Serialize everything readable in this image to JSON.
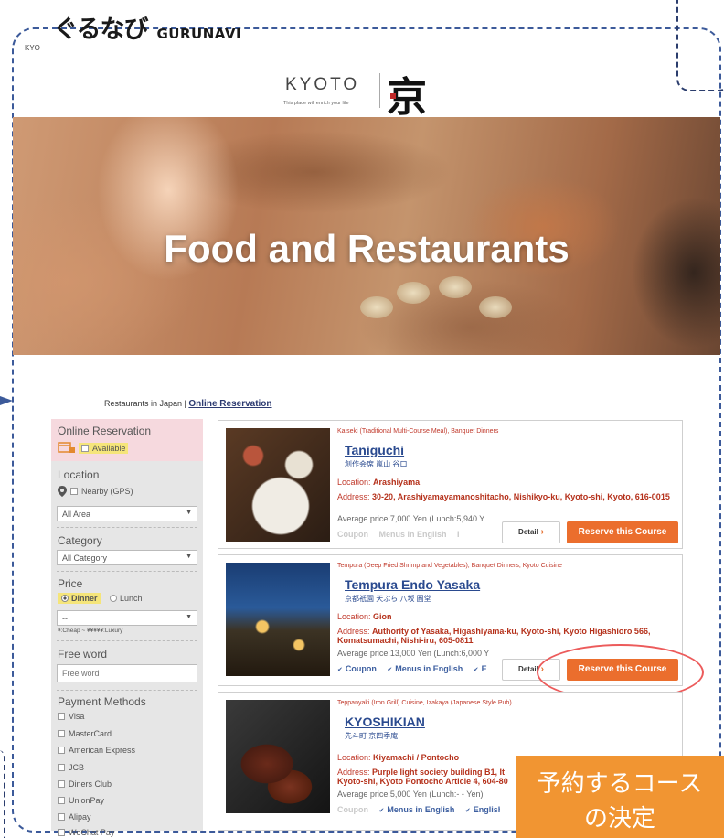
{
  "logo": {
    "jp": "ぐるなび",
    "en": "GURUNAVI"
  },
  "stray_text": "KYO",
  "brand": {
    "word": "KYOTO",
    "tagline": "This place will enrich your life",
    "kanji": "京"
  },
  "hero": {
    "title": "Food and Restaurants"
  },
  "breadcrumb": {
    "prefix": "Restaurants in Japan | ",
    "link": "Online Reservation"
  },
  "sidebar": {
    "online": {
      "heading": "Online Reservation",
      "available": "Available"
    },
    "location": {
      "heading": "Location",
      "gps": "Nearby (GPS)",
      "area": "All Area"
    },
    "category": {
      "heading": "Category",
      "value": "All Category"
    },
    "price": {
      "heading": "Price",
      "dinner": "Dinner",
      "lunch": "Lunch",
      "select": "--",
      "legend": "¥:Cheap ~ ¥¥¥¥¥:Luxury"
    },
    "freeword": {
      "heading": "Free word",
      "placeholder": "Free word"
    },
    "payment": {
      "heading": "Payment Methods",
      "methods": [
        "Visa",
        "MasterCard",
        "American Express",
        "JCB",
        "Diners Club",
        "UnionPay",
        "Alipay",
        "WeChat Pay"
      ]
    }
  },
  "restaurants": [
    {
      "genre": "Kaiseki (Traditional Multi-Course Meal), Banquet Dinners",
      "name": "Taniguchi",
      "name_jp": "創作会席 嵐山 谷口",
      "location_label": "Location:",
      "location": "Arashiyama",
      "address_label": "Address:",
      "address": "30-20, Arashiyamayamanoshitacho, Nishikyo-ku, Kyoto-shi, Kyoto, 616-0015",
      "price": "Average price:7,000 Yen (Lunch:5,940 Y",
      "tags": [
        "Coupon",
        "Menus in English",
        "I"
      ],
      "tags_active": false
    },
    {
      "genre": "Tempura (Deep Fried Shrimp and Vegetables), Banquet Dinners, Kyoto Cuisine",
      "name": "Tempura Endo Yasaka",
      "name_jp": "京都祇園 天ぷら 八坂 圓堂",
      "location_label": "Location:",
      "location": "Gion",
      "address_label": "Address:",
      "address": "Authority of Yasaka, Higashiyama-ku, Kyoto-shi, Kyoto Higashioro 566, Komatsumachi, Nishi-iru, 605-0811",
      "price": "Average price:13,000 Yen (Lunch:6,000 Y",
      "tags": [
        "Coupon",
        "Menus in English",
        "E"
      ],
      "tags_active": true
    },
    {
      "genre": "Teppanyaki (Iron Grill) Cuisine, Izakaya (Japanese Style Pub)",
      "name": "KYOSHIKIAN",
      "name_jp": "先斗町 京四季庵",
      "location_label": "Location:",
      "location": "Kiyamachi / Pontocho",
      "address_label": "Address:",
      "address": "Purple light society building B1, It Kyoto-shi, Kyoto Pontocho Article 4, 604-80",
      "price": "Average price:5,000 Yen (Lunch:- - Yen)",
      "tags": [
        "Coupon",
        "Menus in English",
        "English"
      ],
      "tags_active": true
    }
  ],
  "buttons": {
    "detail": "Detail",
    "reserve": "Reserve this Course"
  },
  "callout": {
    "line1": "予約するコース",
    "line2": "の決定"
  },
  "colors": {
    "accent": "#eb6e2d",
    "link": "#2a4a8f",
    "genre_red": "#c0392b",
    "highlight": "#ec5b5b",
    "callout": "#f19532"
  }
}
